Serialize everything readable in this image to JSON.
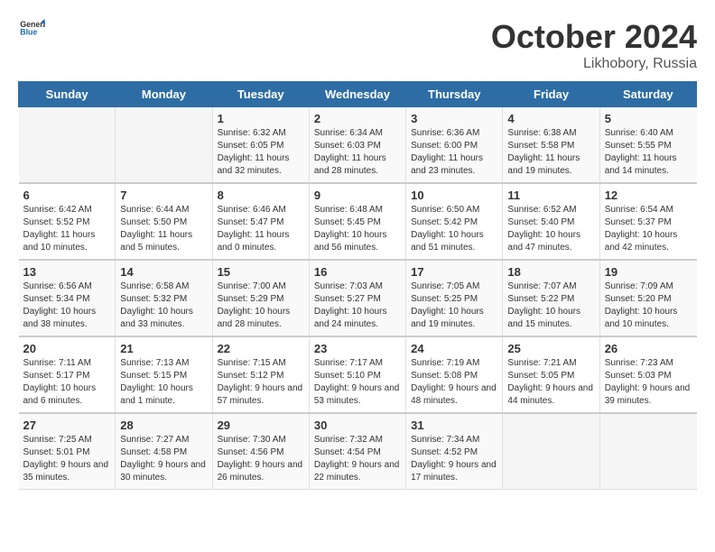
{
  "header": {
    "logo_general": "General",
    "logo_blue": "Blue",
    "month": "October 2024",
    "location": "Likhobory, Russia"
  },
  "days_of_week": [
    "Sunday",
    "Monday",
    "Tuesday",
    "Wednesday",
    "Thursday",
    "Friday",
    "Saturday"
  ],
  "weeks": [
    [
      {
        "day": "",
        "info": ""
      },
      {
        "day": "",
        "info": ""
      },
      {
        "day": "1",
        "info": "Sunrise: 6:32 AM\nSunset: 6:05 PM\nDaylight: 11 hours and 32 minutes."
      },
      {
        "day": "2",
        "info": "Sunrise: 6:34 AM\nSunset: 6:03 PM\nDaylight: 11 hours and 28 minutes."
      },
      {
        "day": "3",
        "info": "Sunrise: 6:36 AM\nSunset: 6:00 PM\nDaylight: 11 hours and 23 minutes."
      },
      {
        "day": "4",
        "info": "Sunrise: 6:38 AM\nSunset: 5:58 PM\nDaylight: 11 hours and 19 minutes."
      },
      {
        "day": "5",
        "info": "Sunrise: 6:40 AM\nSunset: 5:55 PM\nDaylight: 11 hours and 14 minutes."
      }
    ],
    [
      {
        "day": "6",
        "info": "Sunrise: 6:42 AM\nSunset: 5:52 PM\nDaylight: 11 hours and 10 minutes."
      },
      {
        "day": "7",
        "info": "Sunrise: 6:44 AM\nSunset: 5:50 PM\nDaylight: 11 hours and 5 minutes."
      },
      {
        "day": "8",
        "info": "Sunrise: 6:46 AM\nSunset: 5:47 PM\nDaylight: 11 hours and 0 minutes."
      },
      {
        "day": "9",
        "info": "Sunrise: 6:48 AM\nSunset: 5:45 PM\nDaylight: 10 hours and 56 minutes."
      },
      {
        "day": "10",
        "info": "Sunrise: 6:50 AM\nSunset: 5:42 PM\nDaylight: 10 hours and 51 minutes."
      },
      {
        "day": "11",
        "info": "Sunrise: 6:52 AM\nSunset: 5:40 PM\nDaylight: 10 hours and 47 minutes."
      },
      {
        "day": "12",
        "info": "Sunrise: 6:54 AM\nSunset: 5:37 PM\nDaylight: 10 hours and 42 minutes."
      }
    ],
    [
      {
        "day": "13",
        "info": "Sunrise: 6:56 AM\nSunset: 5:34 PM\nDaylight: 10 hours and 38 minutes."
      },
      {
        "day": "14",
        "info": "Sunrise: 6:58 AM\nSunset: 5:32 PM\nDaylight: 10 hours and 33 minutes."
      },
      {
        "day": "15",
        "info": "Sunrise: 7:00 AM\nSunset: 5:29 PM\nDaylight: 10 hours and 28 minutes."
      },
      {
        "day": "16",
        "info": "Sunrise: 7:03 AM\nSunset: 5:27 PM\nDaylight: 10 hours and 24 minutes."
      },
      {
        "day": "17",
        "info": "Sunrise: 7:05 AM\nSunset: 5:25 PM\nDaylight: 10 hours and 19 minutes."
      },
      {
        "day": "18",
        "info": "Sunrise: 7:07 AM\nSunset: 5:22 PM\nDaylight: 10 hours and 15 minutes."
      },
      {
        "day": "19",
        "info": "Sunrise: 7:09 AM\nSunset: 5:20 PM\nDaylight: 10 hours and 10 minutes."
      }
    ],
    [
      {
        "day": "20",
        "info": "Sunrise: 7:11 AM\nSunset: 5:17 PM\nDaylight: 10 hours and 6 minutes."
      },
      {
        "day": "21",
        "info": "Sunrise: 7:13 AM\nSunset: 5:15 PM\nDaylight: 10 hours and 1 minute."
      },
      {
        "day": "22",
        "info": "Sunrise: 7:15 AM\nSunset: 5:12 PM\nDaylight: 9 hours and 57 minutes."
      },
      {
        "day": "23",
        "info": "Sunrise: 7:17 AM\nSunset: 5:10 PM\nDaylight: 9 hours and 53 minutes."
      },
      {
        "day": "24",
        "info": "Sunrise: 7:19 AM\nSunset: 5:08 PM\nDaylight: 9 hours and 48 minutes."
      },
      {
        "day": "25",
        "info": "Sunrise: 7:21 AM\nSunset: 5:05 PM\nDaylight: 9 hours and 44 minutes."
      },
      {
        "day": "26",
        "info": "Sunrise: 7:23 AM\nSunset: 5:03 PM\nDaylight: 9 hours and 39 minutes."
      }
    ],
    [
      {
        "day": "27",
        "info": "Sunrise: 7:25 AM\nSunset: 5:01 PM\nDaylight: 9 hours and 35 minutes."
      },
      {
        "day": "28",
        "info": "Sunrise: 7:27 AM\nSunset: 4:58 PM\nDaylight: 9 hours and 30 minutes."
      },
      {
        "day": "29",
        "info": "Sunrise: 7:30 AM\nSunset: 4:56 PM\nDaylight: 9 hours and 26 minutes."
      },
      {
        "day": "30",
        "info": "Sunrise: 7:32 AM\nSunset: 4:54 PM\nDaylight: 9 hours and 22 minutes."
      },
      {
        "day": "31",
        "info": "Sunrise: 7:34 AM\nSunset: 4:52 PM\nDaylight: 9 hours and 17 minutes."
      },
      {
        "day": "",
        "info": ""
      },
      {
        "day": "",
        "info": ""
      }
    ]
  ]
}
